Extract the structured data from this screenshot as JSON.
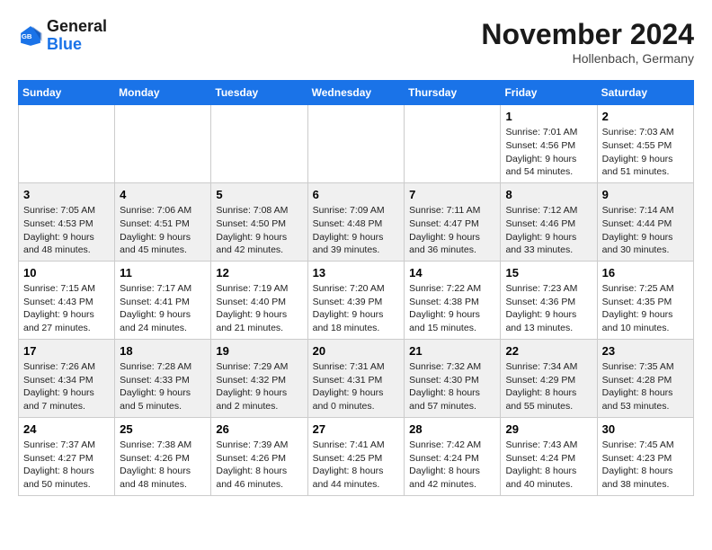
{
  "logo": {
    "line1": "General",
    "line2": "Blue"
  },
  "title": "November 2024",
  "location": "Hollenbach, Germany",
  "headers": [
    "Sunday",
    "Monday",
    "Tuesday",
    "Wednesday",
    "Thursday",
    "Friday",
    "Saturday"
  ],
  "weeks": [
    [
      {
        "day": "",
        "info": ""
      },
      {
        "day": "",
        "info": ""
      },
      {
        "day": "",
        "info": ""
      },
      {
        "day": "",
        "info": ""
      },
      {
        "day": "",
        "info": ""
      },
      {
        "day": "1",
        "info": "Sunrise: 7:01 AM\nSunset: 4:56 PM\nDaylight: 9 hours and 54 minutes."
      },
      {
        "day": "2",
        "info": "Sunrise: 7:03 AM\nSunset: 4:55 PM\nDaylight: 9 hours and 51 minutes."
      }
    ],
    [
      {
        "day": "3",
        "info": "Sunrise: 7:05 AM\nSunset: 4:53 PM\nDaylight: 9 hours and 48 minutes."
      },
      {
        "day": "4",
        "info": "Sunrise: 7:06 AM\nSunset: 4:51 PM\nDaylight: 9 hours and 45 minutes."
      },
      {
        "day": "5",
        "info": "Sunrise: 7:08 AM\nSunset: 4:50 PM\nDaylight: 9 hours and 42 minutes."
      },
      {
        "day": "6",
        "info": "Sunrise: 7:09 AM\nSunset: 4:48 PM\nDaylight: 9 hours and 39 minutes."
      },
      {
        "day": "7",
        "info": "Sunrise: 7:11 AM\nSunset: 4:47 PM\nDaylight: 9 hours and 36 minutes."
      },
      {
        "day": "8",
        "info": "Sunrise: 7:12 AM\nSunset: 4:46 PM\nDaylight: 9 hours and 33 minutes."
      },
      {
        "day": "9",
        "info": "Sunrise: 7:14 AM\nSunset: 4:44 PM\nDaylight: 9 hours and 30 minutes."
      }
    ],
    [
      {
        "day": "10",
        "info": "Sunrise: 7:15 AM\nSunset: 4:43 PM\nDaylight: 9 hours and 27 minutes."
      },
      {
        "day": "11",
        "info": "Sunrise: 7:17 AM\nSunset: 4:41 PM\nDaylight: 9 hours and 24 minutes."
      },
      {
        "day": "12",
        "info": "Sunrise: 7:19 AM\nSunset: 4:40 PM\nDaylight: 9 hours and 21 minutes."
      },
      {
        "day": "13",
        "info": "Sunrise: 7:20 AM\nSunset: 4:39 PM\nDaylight: 9 hours and 18 minutes."
      },
      {
        "day": "14",
        "info": "Sunrise: 7:22 AM\nSunset: 4:38 PM\nDaylight: 9 hours and 15 minutes."
      },
      {
        "day": "15",
        "info": "Sunrise: 7:23 AM\nSunset: 4:36 PM\nDaylight: 9 hours and 13 minutes."
      },
      {
        "day": "16",
        "info": "Sunrise: 7:25 AM\nSunset: 4:35 PM\nDaylight: 9 hours and 10 minutes."
      }
    ],
    [
      {
        "day": "17",
        "info": "Sunrise: 7:26 AM\nSunset: 4:34 PM\nDaylight: 9 hours and 7 minutes."
      },
      {
        "day": "18",
        "info": "Sunrise: 7:28 AM\nSunset: 4:33 PM\nDaylight: 9 hours and 5 minutes."
      },
      {
        "day": "19",
        "info": "Sunrise: 7:29 AM\nSunset: 4:32 PM\nDaylight: 9 hours and 2 minutes."
      },
      {
        "day": "20",
        "info": "Sunrise: 7:31 AM\nSunset: 4:31 PM\nDaylight: 9 hours and 0 minutes."
      },
      {
        "day": "21",
        "info": "Sunrise: 7:32 AM\nSunset: 4:30 PM\nDaylight: 8 hours and 57 minutes."
      },
      {
        "day": "22",
        "info": "Sunrise: 7:34 AM\nSunset: 4:29 PM\nDaylight: 8 hours and 55 minutes."
      },
      {
        "day": "23",
        "info": "Sunrise: 7:35 AM\nSunset: 4:28 PM\nDaylight: 8 hours and 53 minutes."
      }
    ],
    [
      {
        "day": "24",
        "info": "Sunrise: 7:37 AM\nSunset: 4:27 PM\nDaylight: 8 hours and 50 minutes."
      },
      {
        "day": "25",
        "info": "Sunrise: 7:38 AM\nSunset: 4:26 PM\nDaylight: 8 hours and 48 minutes."
      },
      {
        "day": "26",
        "info": "Sunrise: 7:39 AM\nSunset: 4:26 PM\nDaylight: 8 hours and 46 minutes."
      },
      {
        "day": "27",
        "info": "Sunrise: 7:41 AM\nSunset: 4:25 PM\nDaylight: 8 hours and 44 minutes."
      },
      {
        "day": "28",
        "info": "Sunrise: 7:42 AM\nSunset: 4:24 PM\nDaylight: 8 hours and 42 minutes."
      },
      {
        "day": "29",
        "info": "Sunrise: 7:43 AM\nSunset: 4:24 PM\nDaylight: 8 hours and 40 minutes."
      },
      {
        "day": "30",
        "info": "Sunrise: 7:45 AM\nSunset: 4:23 PM\nDaylight: 8 hours and 38 minutes."
      }
    ]
  ]
}
